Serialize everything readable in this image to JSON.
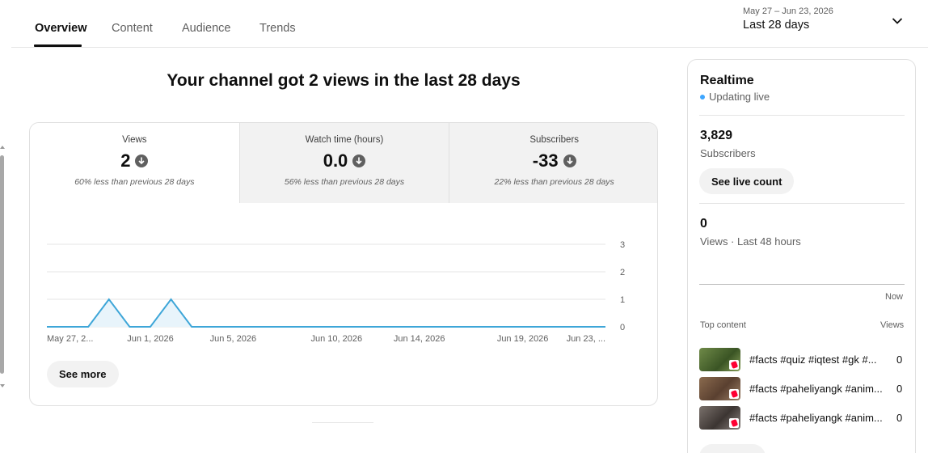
{
  "tabs": [
    {
      "label": "Overview",
      "active": true
    },
    {
      "label": "Content",
      "active": false
    },
    {
      "label": "Audience",
      "active": false
    },
    {
      "label": "Trends",
      "active": false
    }
  ],
  "date_range": {
    "subtitle": "May 27 – Jun 23, 2026",
    "label": "Last 28 days"
  },
  "headline": "Your channel got 2 views in the last 28 days",
  "metrics": [
    {
      "label": "Views",
      "value": "2",
      "delta": "60% less than previous 28 days",
      "selected": true
    },
    {
      "label": "Watch time (hours)",
      "value": "0.0",
      "delta": "56% less than previous 28 days",
      "selected": false
    },
    {
      "label": "Subscribers",
      "value": "-33",
      "delta": "22% less than previous 28 days",
      "selected": false
    }
  ],
  "chart_data": {
    "type": "area",
    "x": [
      "May 27",
      "May 28",
      "May 29",
      "May 30",
      "May 31",
      "Jun 1",
      "Jun 2",
      "Jun 3",
      "Jun 4",
      "Jun 5",
      "Jun 6",
      "Jun 7",
      "Jun 8",
      "Jun 9",
      "Jun 10",
      "Jun 11",
      "Jun 12",
      "Jun 13",
      "Jun 14",
      "Jun 15",
      "Jun 16",
      "Jun 17",
      "Jun 18",
      "Jun 19",
      "Jun 20",
      "Jun 21",
      "Jun 22",
      "Jun 23"
    ],
    "values": [
      0,
      0,
      0,
      1,
      0,
      0,
      1,
      0,
      0,
      0,
      0,
      0,
      0,
      0,
      0,
      0,
      0,
      0,
      0,
      0,
      0,
      0,
      0,
      0,
      0,
      0,
      0,
      0
    ],
    "tick_labels": [
      {
        "index": 0,
        "label": "May 27, 2..."
      },
      {
        "index": 5,
        "label": "Jun 1, 2026"
      },
      {
        "index": 9,
        "label": "Jun 5, 2026"
      },
      {
        "index": 14,
        "label": "Jun 10, 2026"
      },
      {
        "index": 18,
        "label": "Jun 14, 2026"
      },
      {
        "index": 23,
        "label": "Jun 19, 2026"
      },
      {
        "index": 27,
        "label": "Jun 23, ..."
      }
    ],
    "y_ticks": [
      0,
      1,
      2,
      3
    ],
    "ylim": [
      0,
      3
    ],
    "color": "#3ea6d8",
    "fill": "#e8f4fb",
    "grid": true
  },
  "see_more_label": "See more",
  "realtime": {
    "title": "Realtime",
    "status": "Updating live",
    "status_color": "#3ea6ff",
    "subscribers_value": "3,829",
    "subscribers_label": "Subscribers",
    "live_count_label": "See live count",
    "views_value": "0",
    "views_label": "Views · Last 48 hours",
    "now_label": "Now",
    "top_content_label": "Top content",
    "views_header": "Views",
    "items": [
      {
        "title": "#facts #quiz #iqtest #gk #...",
        "views": "0",
        "thumb_color": "#4f6b34"
      },
      {
        "title": "#facts #paheliyangk #anim...",
        "views": "0",
        "thumb_color": "#6e5540"
      },
      {
        "title": "#facts #paheliyangk #anim...",
        "views": "0",
        "thumb_color": "#5a5350"
      }
    ]
  }
}
